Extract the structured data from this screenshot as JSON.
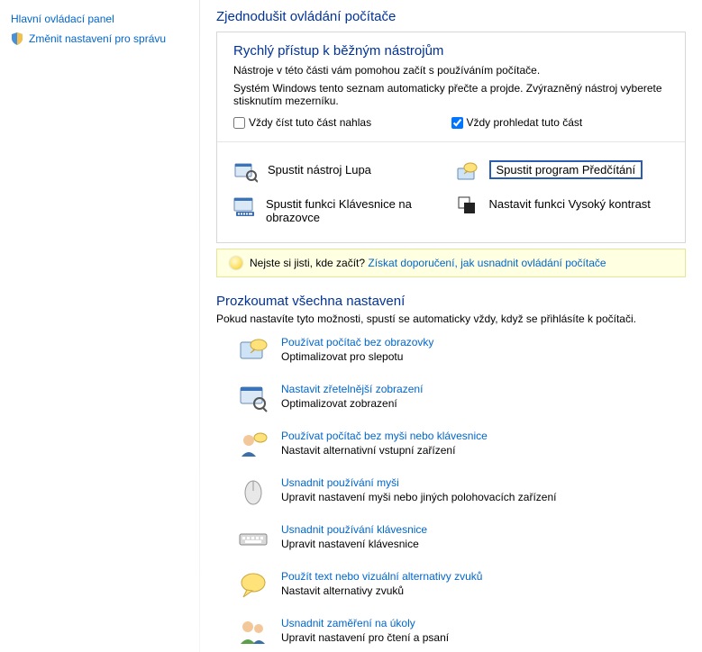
{
  "sidebar": {
    "home": "Hlavní ovládací panel",
    "admin": "Změnit nastavení pro správu"
  },
  "page_title": "Zjednodušit ovládání počítače",
  "quick": {
    "title": "Rychlý přístup k běžným nástrojům",
    "line1": "Nástroje v této části vám pomohou začít s používáním počítače.",
    "line2": "Systém Windows tento seznam automaticky přečte a projde. Zvýrazněný nástroj vyberete stisknutím mezerníku.",
    "cb_read": "Vždy číst tuto část nahlas",
    "cb_scan": "Vždy prohledat tuto část",
    "cb_scan_checked": true,
    "tools": [
      {
        "label": "Spustit nástroj Lupa",
        "name": "tool-magnifier"
      },
      {
        "label": "Spustit program Předčítání",
        "name": "tool-narrator",
        "highlighted": true
      },
      {
        "label": "Spustit funkci Klávesnice na obrazovce",
        "name": "tool-osk"
      },
      {
        "label": "Nastavit funkci Vysoký kontrast",
        "name": "tool-high-contrast"
      }
    ]
  },
  "tip": {
    "prefix": "Nejste si jisti, kde začít?",
    "link": "Získat doporučení, jak usnadnit ovládání počítače"
  },
  "explore": {
    "title": "Prozkoumat všechna nastavení",
    "desc": "Pokud nastavíte tyto možnosti, spustí se automaticky vždy, když se přihlásíte k počítači.",
    "items": [
      {
        "link": "Používat počítač bez obrazovky",
        "desc": "Optimalizovat pro slepotu"
      },
      {
        "link": "Nastavit zřetelnější zobrazení",
        "desc": "Optimalizovat zobrazení"
      },
      {
        "link": "Používat počítač bez myši nebo klávesnice",
        "desc": "Nastavit alternativní vstupní zařízení"
      },
      {
        "link": "Usnadnit používání myši",
        "desc": "Upravit nastavení myši nebo jiných polohovacích zařízení"
      },
      {
        "link": "Usnadnit používání klávesnice",
        "desc": "Upravit nastavení klávesnice"
      },
      {
        "link": "Použít text nebo vizuální alternativy zvuků",
        "desc": "Nastavit alternativy zvuků"
      },
      {
        "link": "Usnadnit zaměření na úkoly",
        "desc": "Upravit nastavení pro čtení a psaní"
      }
    ]
  }
}
